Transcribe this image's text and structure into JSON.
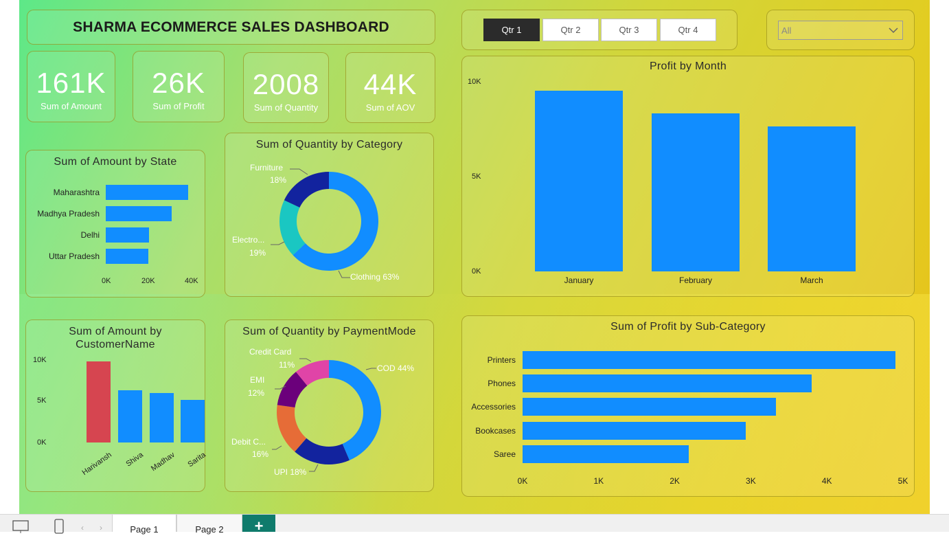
{
  "dashboard": {
    "title": "SHARMA ECOMMERCE SALES DASHBOARD"
  },
  "kpis": [
    {
      "value": "161K",
      "label": "Sum of Amount"
    },
    {
      "value": "26K",
      "label": "Sum of Profit"
    },
    {
      "value": "2008",
      "label": "Sum of Quantity"
    },
    {
      "value": "44K",
      "label": "Sum of AOV"
    }
  ],
  "quarter_slicer": {
    "buttons": [
      "Qtr 1",
      "Qtr 2",
      "Qtr 3",
      "Qtr 4"
    ],
    "selected": "Qtr 1"
  },
  "state_dropdown": {
    "value": "All"
  },
  "colors": {
    "bar": "#118dff",
    "highlight": "#d64550",
    "navy": "#12239e",
    "teal": "#1ac7c2",
    "orange": "#e66c37",
    "purple": "#6b007b",
    "pink": "#e044a7"
  },
  "chart_data": [
    {
      "id": "amount_by_state",
      "type": "bar",
      "orientation": "horizontal",
      "title": "Sum of Amount by State",
      "categories": [
        "Maharashtra",
        "Madhya Pradesh",
        "Delhi",
        "Uttar Pradesh"
      ],
      "values": [
        37000,
        29500,
        19500,
        19000
      ],
      "xticks": [
        "0K",
        "20K",
        "40K"
      ],
      "xlim": [
        0,
        40000
      ]
    },
    {
      "id": "quantity_by_category",
      "type": "pie",
      "donut": true,
      "title": "Sum of Quantity by Category",
      "slices": [
        {
          "label": "Clothing",
          "label_text": "Clothing 63%",
          "percent": 63
        },
        {
          "label": "Electronics",
          "label_text": "Electro...",
          "pct_text": "19%",
          "percent": 19
        },
        {
          "label": "Furniture",
          "label_text": "Furniture",
          "pct_text": "18%",
          "percent": 18
        }
      ]
    },
    {
      "id": "profit_by_month",
      "type": "bar",
      "title": "Profit by Month",
      "categories": [
        "January",
        "February",
        "March"
      ],
      "values": [
        9900,
        8650,
        7950
      ],
      "yticks": [
        "0K",
        "5K",
        "10K"
      ],
      "ylim": [
        0,
        10000
      ]
    },
    {
      "id": "amount_by_customer",
      "type": "bar",
      "title": "Sum of Amount by CustomerName",
      "title_lines": [
        "Sum of Amount by",
        "CustomerName"
      ],
      "categories": [
        "Harivansh",
        "Shiva",
        "Madhav",
        "Sarita"
      ],
      "values": [
        9800,
        6300,
        6000,
        5200
      ],
      "highlight_index": 0,
      "yticks": [
        "0K",
        "5K",
        "10K"
      ],
      "ylim": [
        0,
        10000
      ]
    },
    {
      "id": "quantity_by_paymentmode",
      "type": "pie",
      "donut": true,
      "title": "Sum of Quantity by PaymentMode",
      "slices": [
        {
          "label": "COD",
          "label_text": "COD 44%",
          "percent": 44
        },
        {
          "label": "UPI",
          "label_text": "UPI 18%",
          "percent": 18
        },
        {
          "label": "Debit Card",
          "label_text": "Debit C...",
          "pct_text": "16%",
          "percent": 16
        },
        {
          "label": "EMI",
          "label_text": "EMI",
          "pct_text": "12%",
          "percent": 12
        },
        {
          "label": "Credit Card",
          "label_text": "Credit Card",
          "pct_text": "11%",
          "percent": 11
        }
      ]
    },
    {
      "id": "profit_by_subcategory",
      "type": "bar",
      "orientation": "horizontal",
      "title": "Sum of Profit by Sub-Category",
      "categories": [
        "Printers",
        "Phones",
        "Accessories",
        "Bookcases",
        "Saree"
      ],
      "values": [
        4900,
        3800,
        3330,
        2930,
        2180
      ],
      "xticks": [
        "0K",
        "1K",
        "2K",
        "3K",
        "4K",
        "5K"
      ],
      "xlim": [
        0,
        5000
      ]
    }
  ],
  "page_tabs": [
    "Page 1",
    "Page 2"
  ],
  "add_page": "+"
}
